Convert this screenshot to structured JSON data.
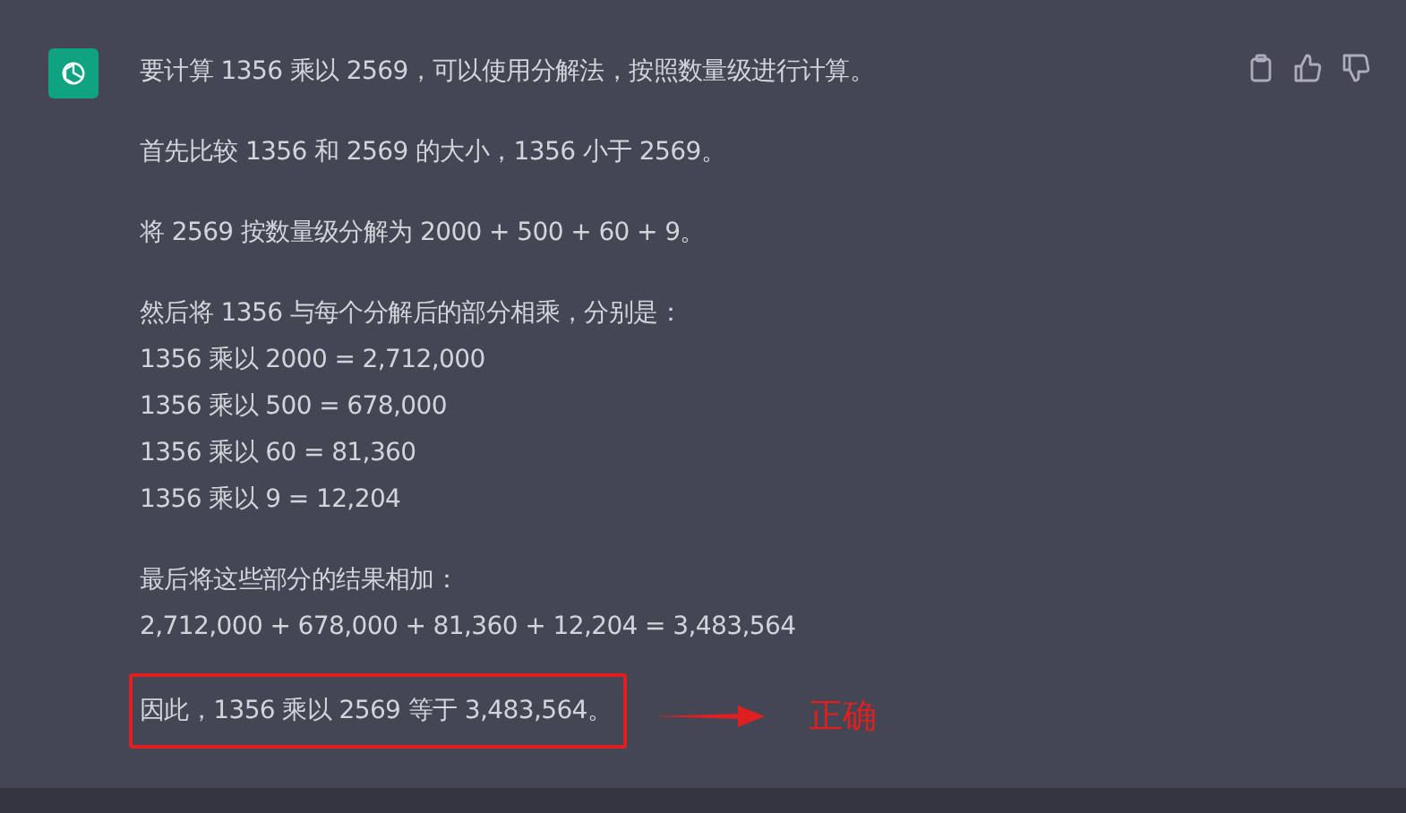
{
  "message": {
    "paragraphs": [
      {
        "highlighted": false,
        "lines": [
          "要计算 1356 乘以 2569，可以使用分解法，按照数量级进行计算。"
        ]
      },
      {
        "highlighted": false,
        "lines": [
          "首先比较 1356 和 2569 的大小，1356 小于 2569。"
        ]
      },
      {
        "highlighted": false,
        "lines": [
          "将 2569 按数量级分解为 2000 + 500 + 60 + 9。"
        ]
      },
      {
        "highlighted": false,
        "lines": [
          "然后将 1356 与每个分解后的部分相乘，分别是：",
          "1356 乘以 2000 = 2,712,000",
          "1356 乘以 500 = 678,000",
          "1356 乘以 60 = 81,360",
          "1356 乘以 9 = 12,204"
        ]
      },
      {
        "highlighted": false,
        "lines": [
          "最后将这些部分的结果相加：",
          "2,712,000 + 678,000 + 81,360 + 12,204 = 3,483,564"
        ]
      },
      {
        "highlighted": true,
        "lines": [
          "因此，1356 乘以 2569 等于 3,483,564。"
        ]
      }
    ]
  },
  "annotation": {
    "label": "正确"
  }
}
